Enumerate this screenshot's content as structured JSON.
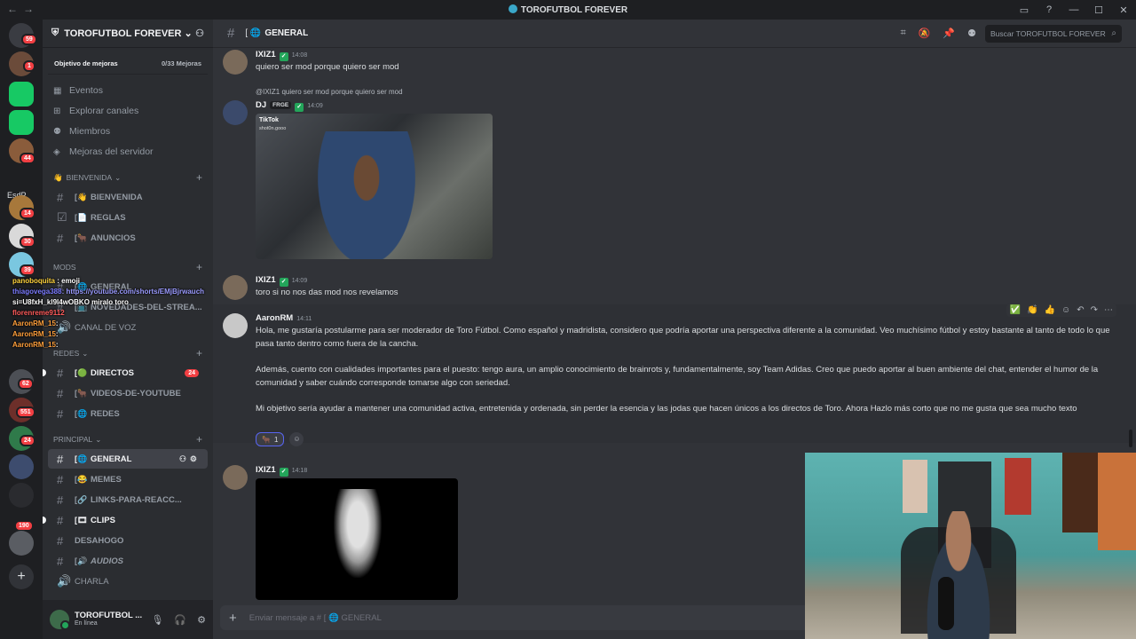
{
  "window": {
    "title": "TOROFUTBOL FOREVER",
    "controls": [
      "inbox-icon",
      "help-icon",
      "minimize-icon",
      "maximize-icon",
      "close-icon"
    ]
  },
  "rail": {
    "badges": [
      "59",
      "1",
      "14",
      "44",
      "14",
      "30",
      "39",
      "62",
      "551",
      "24",
      "190"
    ],
    "label_esdp": "EsdP"
  },
  "server": {
    "name": "TOROFUTBOL FOREVER",
    "boost_goal": "Objetivo de mejoras",
    "boost_count": "0/33 Mejoras",
    "nav": [
      {
        "label": "Eventos",
        "icon": "calendar-icon"
      },
      {
        "label": "Explorar canales",
        "icon": "compass-icon"
      },
      {
        "label": "Miembros",
        "icon": "members-icon"
      },
      {
        "label": "Mejoras del servidor",
        "icon": "boost-icon"
      }
    ],
    "categories": {
      "bienvenida": "BIENVENIDA",
      "mods": "MODS",
      "redes": "REDES",
      "principal": "PRINCIPAL"
    },
    "channels": {
      "bienvenida": "BIENVENIDA",
      "reglas": "REGLAS",
      "anuncios": "ANUNCIOS",
      "general_mods": "GENERAL",
      "novedades": "NOVEDADES-DEL-STREA...",
      "canal_voz": "CANAL DE VOZ",
      "directos": "DIRECTOS",
      "directos_count": "24",
      "videos": "VIDEOS-DE-YOUTUBE",
      "redes": "REDES",
      "general": "GENERAL",
      "memes": "MEMES",
      "links": "LINKS-PARA-REACC...",
      "clips": "CLIPS",
      "desahogo": "DESAHOGO",
      "audios": "AUDIOS",
      "charla": "CHARLA"
    }
  },
  "user": {
    "name": "TOROFUTBOL ...",
    "status": "En línea"
  },
  "stream_chat": [
    {
      "name": "panoboquita",
      "text": ": emoji"
    },
    {
      "name": "thiagovega388",
      "text": ": https://youtube.com/shorts/EMjBjrwauch"
    },
    {
      "name": "",
      "text": "si=U8fxH_kl9l4wOBKO miralo toro"
    },
    {
      "name": "florenreme9112",
      "text": ""
    },
    {
      "name": "AaronRM_15",
      "text": ":"
    },
    {
      "name": "AaronRM_15",
      "text": ":"
    },
    {
      "name": "AaronRM_15",
      "text": ":"
    }
  ],
  "channel": {
    "name": "GENERAL",
    "search_placeholder": "Buscar TOROFUTBOL FOREVER"
  },
  "messages": [
    {
      "author": "IXIZ1",
      "time": "14:08",
      "text": "quiero ser mod porque quiero ser mod"
    },
    {
      "reply_to": "@IXIZ1 quiero ser mod porque quiero ser mod",
      "author": "DJ",
      "tag": "FRGE",
      "time": "14:09",
      "embed_label": "TikTok",
      "embed_sub": "shot0n.gooo"
    },
    {
      "author": "IXIZ1",
      "time": "14:09",
      "text": "toro si no nos das mod nos revelamos"
    },
    {
      "author": "AaronRM",
      "time": "14:11",
      "p1": "Hola, me gustaría postularme para ser moderador de Toro Fútbol. Como español y madridista, considero que podría aportar una perspectiva diferente a la comunidad. Veo muchísimo fútbol y estoy bastante al tanto de todo lo que pasa tanto dentro como fuera de la cancha.",
      "p2": "Además, cuento con cualidades importantes para el puesto: tengo aura, un amplio conocimiento de brainrots y, fundamentalmente, soy Team Adidas. Creo que puedo aportar al buen ambiente del chat, entender el humor de la comunidad y saber cuándo corresponde tomarse algo con seriedad.",
      "p3": "Mi objetivo sería ayudar a mantener una comunidad activa, entretenida y ordenada, sin perder la esencia y las jodas que hacen únicos a los directos de Toro. Ahora Hazlo más corto que no me gusta que sea mucho texto",
      "reaction_count": "1"
    },
    {
      "author": "IXIZ1",
      "time": "14:18"
    }
  ],
  "composer": {
    "placeholder": "Enviar mensaje a #  [ 🌐 GENERAL"
  },
  "colors": {
    "accent": "#5865f2",
    "online": "#23a55a",
    "badge": "#f23f43"
  }
}
